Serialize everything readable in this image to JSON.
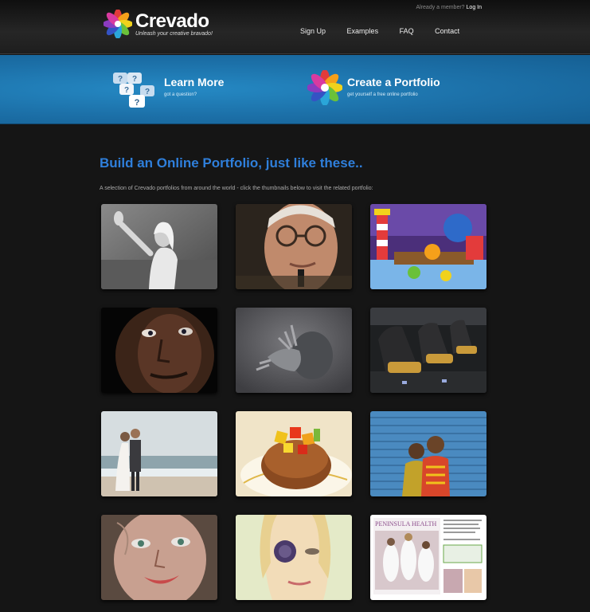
{
  "header": {
    "brand_name": "Crevado",
    "brand_tagline": "Unleash your creative bravado!",
    "member_text": "Already a member?",
    "login_label": "Log In",
    "nav": [
      "Sign Up",
      "Examples",
      "FAQ",
      "Contact"
    ]
  },
  "banner": {
    "learn": {
      "title": "Learn More",
      "subtitle": "got a question?",
      "icon": "question-bubbles-icon"
    },
    "create": {
      "title": "Create a Portfolio",
      "subtitle": "get yourself a free online portfolio",
      "icon": "crevado-flower-icon"
    }
  },
  "main": {
    "headline": "Build an Online Portfolio, just like these..",
    "intro": "A selection of Crevado portfolios from around the world - click the thumbnails below to visit the related portfolio:"
  },
  "thumbnails": [
    "woman-waving",
    "older-man-glasses",
    "cartoon-lighthouse",
    "man-face-closeup",
    "sculpture-grey",
    "futuristic-seats",
    "wedding-beach",
    "dessert-plate",
    "boys-blue-wall",
    "painted-face",
    "woman-flower-eye",
    "magazine-page"
  ],
  "magazine": {
    "title": "PENINSULA HEALTH"
  },
  "colors": {
    "accent": "#2f7fdb",
    "banner": "#1c70a8",
    "background": "#151515"
  }
}
